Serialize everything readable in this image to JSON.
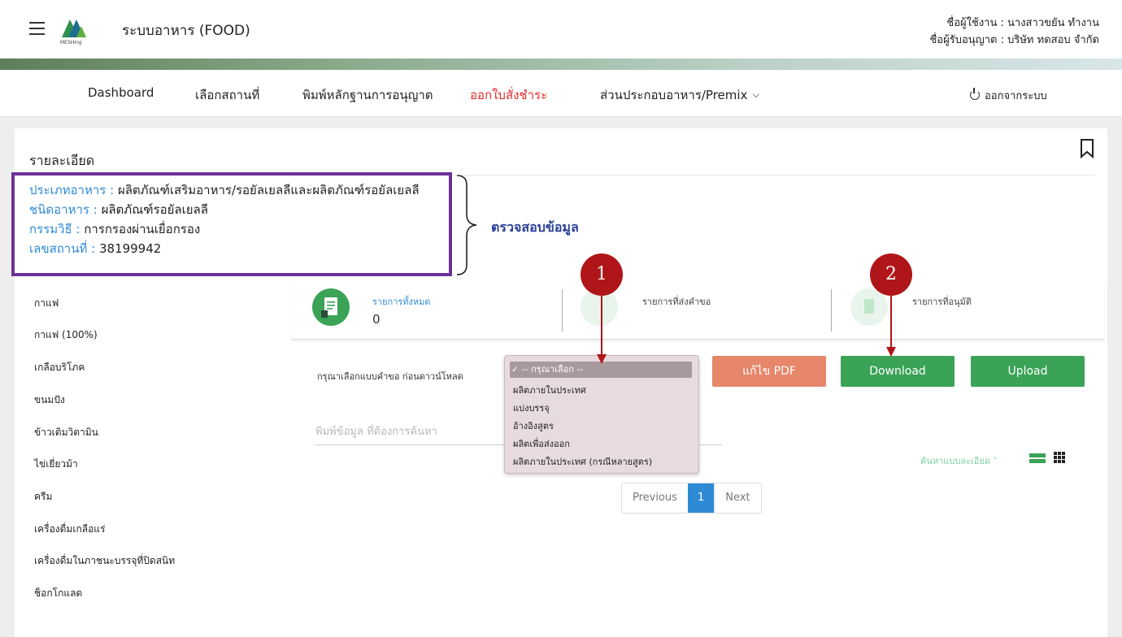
{
  "header": {
    "app_title": "ระบบอาหาร (FOOD)",
    "logo_text": "MESHing",
    "user_line1": "ชื่อผู้ใช้งาน : นางสาวขยัน ทำงาน",
    "user_line2": "ชื่อผู้รับอนุญาต : บริษัท ทดสอบ จำกัด"
  },
  "nav": {
    "items": [
      "Dashboard",
      "เลือกสถานที่",
      "พิมพ์หลักฐานการอนุญาต",
      "ออกใบสั่งชำระ",
      "ส่วนประกอบอาหาร/Premix"
    ],
    "active_index": 3,
    "logout": "ออกจากระบบ"
  },
  "details": {
    "title": "รายละเอียด",
    "food_type_label": "ประเภทอาหาร : ",
    "food_type_value": "ผลิตภัณฑ์เสริมอาหาร/รอยัลเยลลีและผลิตภัณฑ์รอยัลเยลลี",
    "food_kind_label": "ชนิดอาหาร : ",
    "food_kind_value": "ผลิตภัณฑ์รอยัลเยลลี",
    "process_label": "กรรมวิธี : ",
    "process_value": "การกรองผ่านเยื่อกรอง",
    "location_label": "เลขสถานที่ : ",
    "location_value": "38199942"
  },
  "annotation": {
    "check_text": "ตรวจสอบข้อมูล",
    "marker1": "1",
    "marker2": "2"
  },
  "sidebar": {
    "items": [
      "กาแฟ",
      "กาแฟ (100%)",
      "เกลือบริโภค",
      "ขนมปัง",
      "ข้าวเติมวิตามิน",
      "ไข่เยี่ยวม้า",
      "ครีม",
      "เครื่องดื่มเกลือแร่",
      "เครื่องดื่มในภาชนะบรรจุที่ปิดสนิท",
      "ช็อกโกแลต"
    ]
  },
  "stats": {
    "total_label": "รายการทั้งหมด",
    "total_value": "0",
    "submitted_label": "รายการที่ส่งคำขอ",
    "approved_label": "รายการที่อนุมัติ"
  },
  "actions": {
    "filter_label": "กรุณาเลือกแบบคำขอ ก่อนดาวน์โหลด",
    "edit_pdf": "แก้ไข PDF",
    "download": "Download",
    "upload": "Upload"
  },
  "dropdown": {
    "selected": "✓ -- กรุณาเลือก --",
    "options": [
      "ผลิตภายในประเทศ",
      "แบ่งบรรจุ",
      "อ้างอิงสูตร",
      "ผลิตเพื่อส่งออก",
      "ผลิตภายในประเทศ (กรณีหลายสูตร)"
    ]
  },
  "search": {
    "placeholder": "พิมพ์ข้อมูล ที่ต้องการค้นหา",
    "advanced": "ค้นหาแบบละเอียด ˅"
  },
  "pagination": {
    "previous": "Previous",
    "current": "1",
    "next": "Next"
  },
  "colors": {
    "accent_blue": "#2f8ad5",
    "active_red": "#e22b2b",
    "green": "#3aa356",
    "orange": "#e6866a",
    "marker": "#b01619",
    "annotation_purple": "#6c3199"
  }
}
